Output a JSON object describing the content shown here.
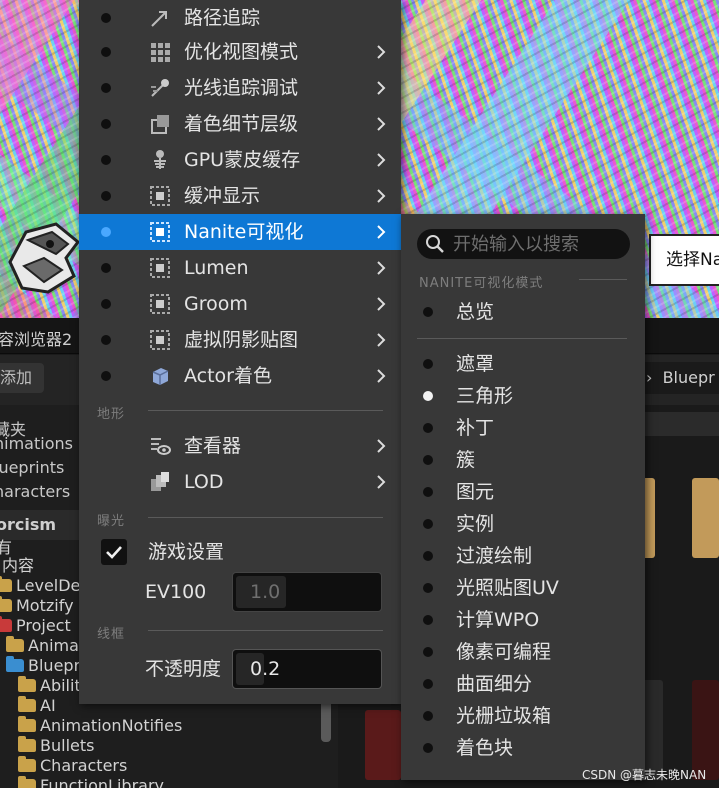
{
  "viewport": {
    "selection_box_text": "选择Na"
  },
  "content_browser": {
    "tab_title": "容浏览器2",
    "add_button": "添加",
    "path_crumb": "Bluepr",
    "favorites_header": "藏夹",
    "favorites": [
      "nimations",
      "lueprints",
      "haracters"
    ],
    "project_section": "orcism",
    "tree": {
      "all": "有",
      "content": "内容",
      "folders": [
        {
          "name": "LevelDes"
        },
        {
          "name": "Motzify"
        },
        {
          "name": "Project"
        },
        {
          "name": "Animat"
        },
        {
          "name": "Bluepr"
        },
        {
          "name": "Abiliti"
        },
        {
          "name": "AI"
        },
        {
          "name": "AnimationNotifies"
        },
        {
          "name": "Bullets"
        },
        {
          "name": "Characters"
        },
        {
          "name": "FunctionLibrary"
        }
      ]
    }
  },
  "menu": {
    "items": [
      {
        "label": "路径追踪",
        "icon": "path-tracing-icon",
        "has_submenu": false
      },
      {
        "label": "优化视图模式",
        "icon": "grid-icon",
        "has_submenu": true
      },
      {
        "label": "光线追踪调试",
        "icon": "ray-debug-icon",
        "has_submenu": true
      },
      {
        "label": "着色细节层级",
        "icon": "shading-lod-icon",
        "has_submenu": true
      },
      {
        "label": "GPU蒙皮缓存",
        "icon": "skeleton-icon",
        "has_submenu": true
      },
      {
        "label": "缓冲显示",
        "icon": "buffer-icon",
        "has_submenu": true
      },
      {
        "label": "Nanite可视化",
        "icon": "nanite-icon",
        "has_submenu": true,
        "active": true
      },
      {
        "label": "Lumen",
        "icon": "lumen-icon",
        "has_submenu": true
      },
      {
        "label": "Groom",
        "icon": "groom-icon",
        "has_submenu": true
      },
      {
        "label": "虚拟阴影贴图",
        "icon": "vsm-icon",
        "has_submenu": true
      },
      {
        "label": "Actor着色",
        "icon": "cube-icon",
        "has_submenu": true
      }
    ],
    "section_landscape": "地形",
    "landscape_items": [
      {
        "label": "查看器",
        "icon": "viewer-icon"
      },
      {
        "label": "LOD",
        "icon": "lod-icon"
      }
    ],
    "section_exposure": "曝光",
    "game_settings_label": "游戏设置",
    "game_settings_checked": true,
    "ev100_label": "EV100",
    "ev100_value": "1.0",
    "section_wireframe": "线框",
    "opacity_label": "不透明度",
    "opacity_value": "0.2"
  },
  "submenu": {
    "search_placeholder": "开始输入以搜索",
    "section_title": "NANITE可视化模式",
    "overview": "总览",
    "items": [
      "遮罩",
      "三角形",
      "补丁",
      "簇",
      "图元",
      "实例",
      "过渡绘制",
      "光照贴图UV",
      "计算WPO",
      "像素可编程",
      "曲面细分",
      "光栅垃圾箱",
      "着色块"
    ],
    "selected": "三角形"
  },
  "watermark": "CSDN @暮志未晚NAN",
  "colors": {
    "menu_bg": "#383838",
    "active_bg": "#0e78d5",
    "accent_dot": "#4aa8ff"
  }
}
